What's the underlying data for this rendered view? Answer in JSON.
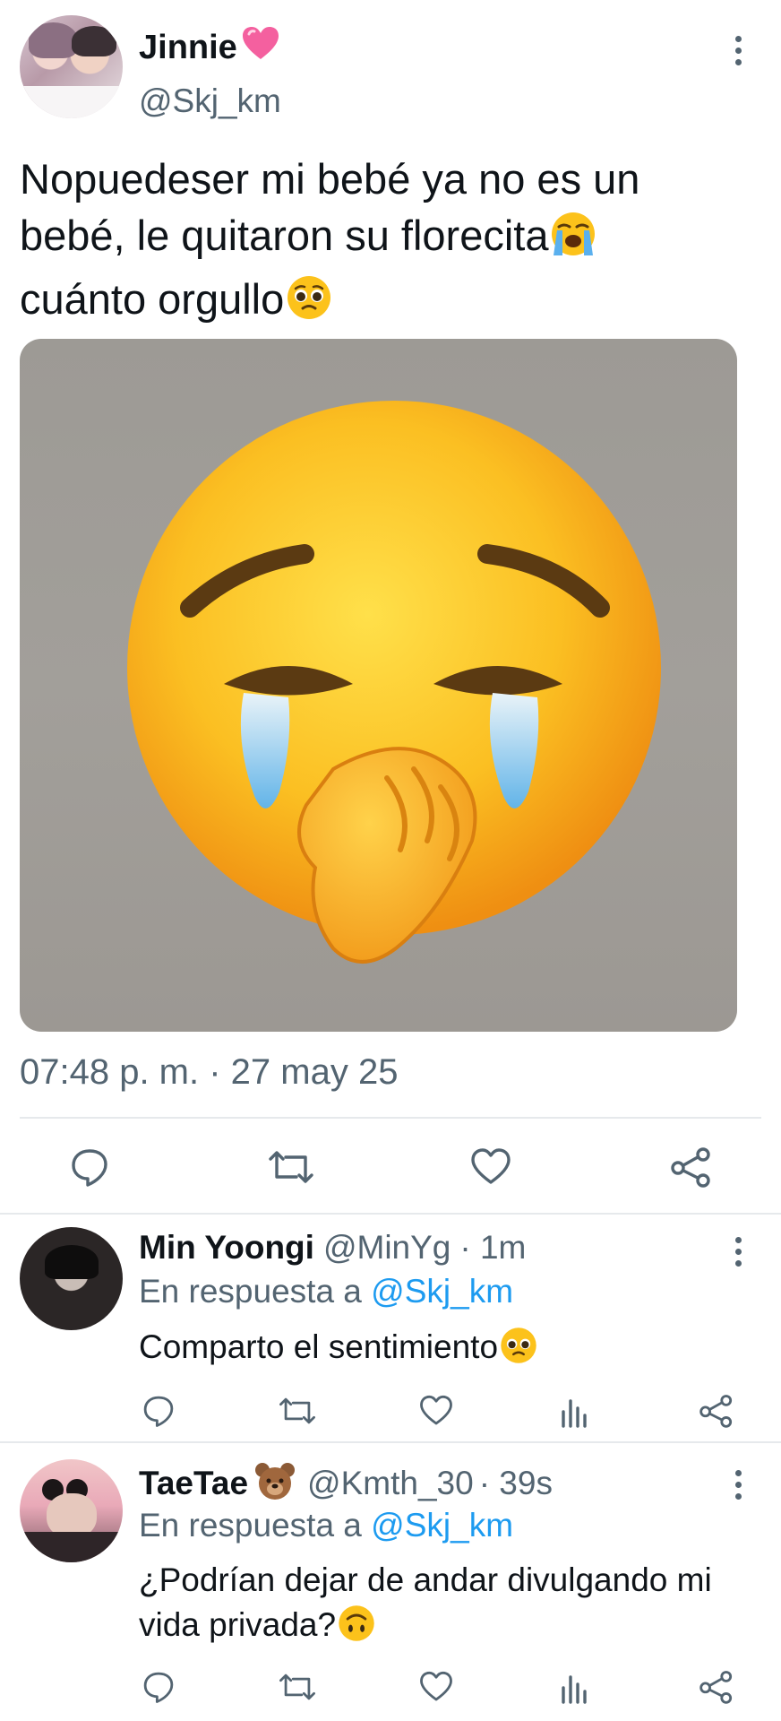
{
  "tweet": {
    "author": {
      "display_name": "Jinnie",
      "name_emoji": "💗",
      "handle": "@Skj_km"
    },
    "text": "Nopuedeser mi bebé ya no es un bebé, le quitaron su florecita",
    "text_emoji_1": "😭",
    "text_line_3": "cuánto orgullo",
    "text_emoji_2": "🥹",
    "media_icon": "crying-face-hand-over-mouth-emoji",
    "timestamp": "07:48 p. m. · 27 may 25",
    "actions": [
      "reply-icon",
      "retweet-icon",
      "like-icon",
      "share-icon"
    ]
  },
  "replies": [
    {
      "display_name": "Min Yoongi",
      "handle": "@MinYg",
      "time": "· 1m",
      "reply_to_prefix": "En respuesta a",
      "reply_to_handle": "@Skj_km",
      "text": "Comparto el sentimiento",
      "text_emoji": "🥹"
    },
    {
      "display_name": "TaeTae",
      "name_emoji": "🐻",
      "handle": "@Kmth_30",
      "time": "· 39s",
      "reply_to_prefix": "En respuesta a",
      "reply_to_handle": "@Skj_km",
      "text": "¿Podrían dejar de andar divulgando mi vida privada?",
      "text_emoji": "🙃"
    }
  ],
  "colors": {
    "text": "#0f1419",
    "muted": "#536471",
    "link": "#1d9bf0",
    "divider": "#e6e9ec"
  }
}
